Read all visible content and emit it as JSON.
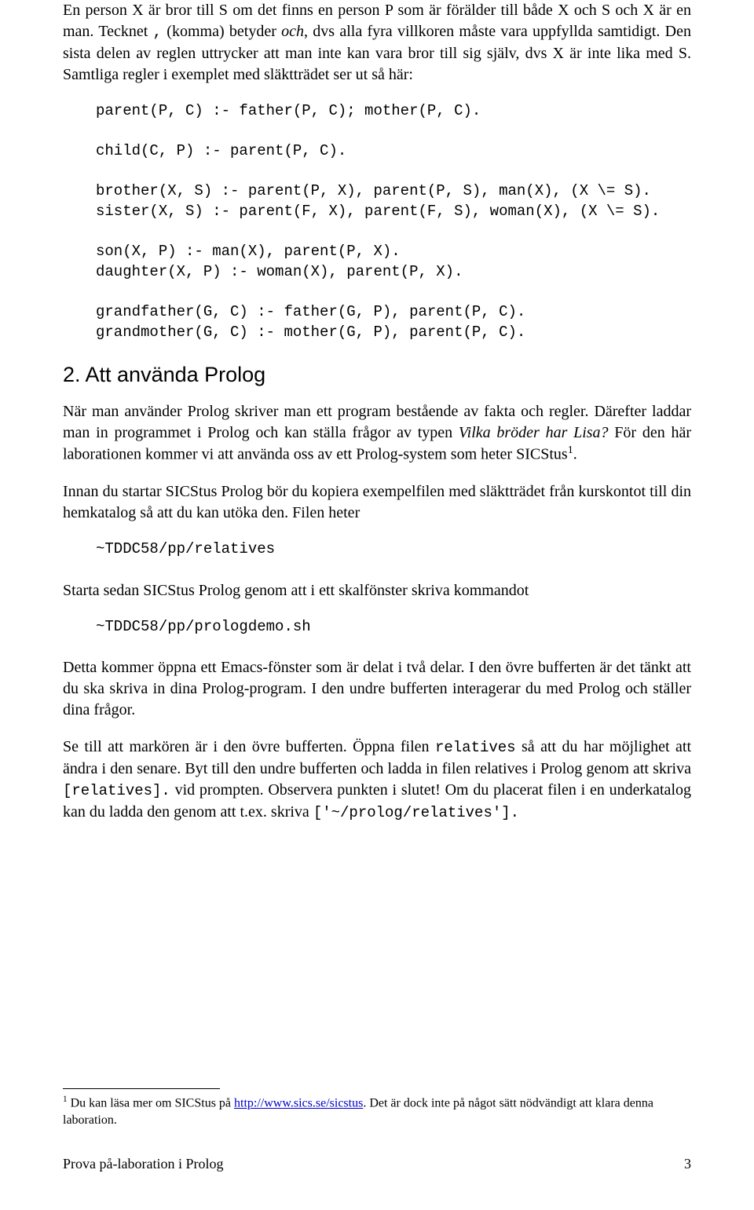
{
  "para1_a": "En person X är bror till S om det finns en person P som är förälder till både X och S och X är en man. Tecknet ",
  "comma_char": ",",
  "para1_b": " (komma) betyder ",
  "och1": "och",
  "para1_c": ", dvs alla fyra villkoren måste vara uppfyllda samtidigt. Den sista delen av reglen uttrycker att man inte kan vara bror till sig själv, dvs X är inte lika med S. Samtliga regler i exemplet med släktträdet ser ut så här:",
  "code1": "parent(P, C) :- father(P, C); mother(P, C).\n\nchild(C, P) :- parent(P, C).\n\nbrother(X, S) :- parent(P, X), parent(P, S), man(X), (X \\= S).\nsister(X, S) :- parent(F, X), parent(F, S), woman(X), (X \\= S).\n\nson(X, P) :- man(X), parent(P, X).\ndaughter(X, P) :- woman(X), parent(P, X).\n\ngrandfather(G, C) :- father(G, P), parent(P, C).\ngrandmother(G, C) :- mother(G, P), parent(P, C).",
  "section_title": "2. Att använda Prolog",
  "para2_a": "När man använder Prolog skriver man ett program bestående av fakta och regler. Därefter laddar man in programmet i Prolog och kan ställa frågor av typen ",
  "italic_q": "Vilka bröder har Lisa?",
  "para2_b": " För den här laborationen kommer vi att använda oss av ett Prolog-system som heter SICStus",
  "fn_marker": "1",
  "para2_c": ".",
  "para3": "Innan du startar SICStus Prolog bör du kopiera exempelfilen med släktträdet från kurskontot till din hemkatalog så att du kan utöka den. Filen heter",
  "code2": "~TDDC58/pp/relatives",
  "para4": "Starta sedan SICStus Prolog genom att i ett skalfönster skriva kommandot",
  "code3": "~TDDC58/pp/prologdemo.sh",
  "para5": "Detta kommer öppna ett Emacs-fönster som är delat i två delar. I den övre bufferten är det tänkt att du ska skriva in dina Prolog-program. I den undre bufferten interagerar du med Prolog och ställer dina frågor.",
  "para6_a": "Se till att markören är i den övre bufferten. Öppna filen ",
  "code_rel": "relatives",
  "para6_b": " så att du har möjlighet att ändra i den senare. Byt till den undre bufferten och ladda in filen relatives i Prolog genom att skriva ",
  "code_rel_br": "[relatives].",
  "para6_c": " vid prompten. Observera punkten i slutet! Om du placerat filen i en underkatalog kan du ladda den genom att t.ex. skriva ",
  "code_load": "['~/prolog/relatives'].",
  "footnote_a": " Du kan läsa mer om SICStus på ",
  "footnote_link": "http://www.sics.se/sicstus",
  "footnote_b": ". Det är dock inte på något sätt nödvändigt att klara denna laboration.",
  "footer_left": "Prova på-laboration i Prolog",
  "footer_right": "3"
}
